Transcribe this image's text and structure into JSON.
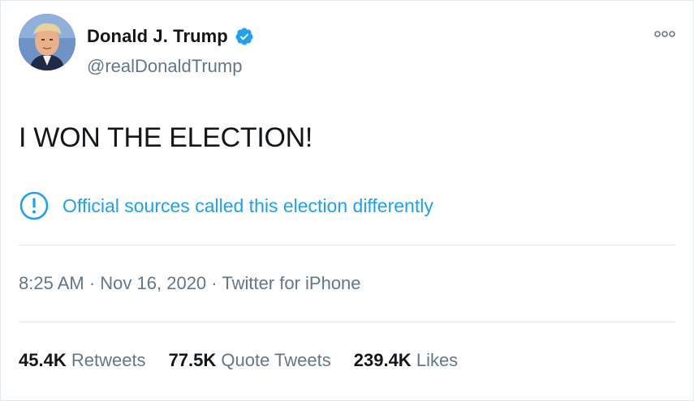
{
  "author": {
    "display_name": "Donald J. Trump",
    "handle": "@realDonaldTrump",
    "verified": true
  },
  "tweet": {
    "text": "I WON THE ELECTION!"
  },
  "notice": {
    "text": "Official sources called this election differently"
  },
  "meta": {
    "time": "8:25 AM",
    "separator": "·",
    "date": "Nov 16, 2020",
    "source": "Twitter for iPhone"
  },
  "stats": [
    {
      "count": "45.4K",
      "label": "Retweets"
    },
    {
      "count": "77.5K",
      "label": "Quote Tweets"
    },
    {
      "count": "239.4K",
      "label": "Likes"
    }
  ],
  "colors": {
    "accent": "#1da1f2",
    "text": "#14171a",
    "muted": "#657786",
    "divider": "#e1e8ed"
  }
}
